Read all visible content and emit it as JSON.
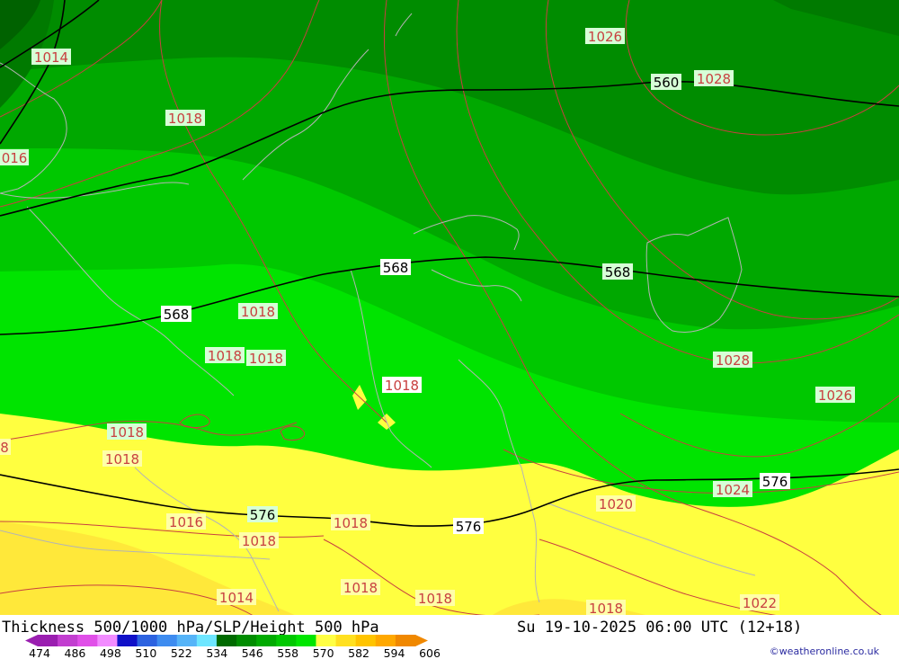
{
  "product_title": "Thickness 500/1000 hPa/SLP/Height 500 hPa",
  "valid_time": "Su 19-10-2025 06:00 UTC (12+18)",
  "credit": "©weatheronline.co.uk",
  "legend": {
    "ticks": [
      "474",
      "486",
      "498",
      "510",
      "522",
      "534",
      "546",
      "558",
      "570",
      "582",
      "594",
      "606"
    ],
    "colors": [
      "#9a1fb0",
      "#c23fd0",
      "#e050e8",
      "#f28cff",
      "#1010c8",
      "#2c62e0",
      "#3e8cf0",
      "#56b4f8",
      "#6ee6ff",
      "#006a00",
      "#008c00",
      "#00aa00",
      "#00c800",
      "#00e600",
      "#ffff44",
      "#ffe020",
      "#ffc400",
      "#ffa800",
      "#f08800"
    ]
  },
  "height_labels": [
    {
      "text": "560"
    },
    {
      "text": "568"
    },
    {
      "text": "568"
    },
    {
      "text": "568"
    },
    {
      "text": "576"
    },
    {
      "text": "576"
    },
    {
      "text": "576"
    }
  ],
  "pressure_labels": [
    {
      "text": "1014"
    },
    {
      "text": "1026"
    },
    {
      "text": "1028"
    },
    {
      "text": "1018"
    },
    {
      "text": "016"
    },
    {
      "text": "1018"
    },
    {
      "text": "1018"
    },
    {
      "text": "1018"
    },
    {
      "text": "1018"
    },
    {
      "text": "1028"
    },
    {
      "text": "1026"
    },
    {
      "text": "1018"
    },
    {
      "text": "1018"
    },
    {
      "text": "1024"
    },
    {
      "text": "1020"
    },
    {
      "text": "1016"
    },
    {
      "text": "1018"
    },
    {
      "text": "1018"
    },
    {
      "text": "1014"
    },
    {
      "text": "1018"
    },
    {
      "text": "1018"
    },
    {
      "text": "1018"
    },
    {
      "text": "1022"
    },
    {
      "text": "8"
    }
  ],
  "colors": {
    "green_darkest": "#007a00",
    "green_dark": "#008c00",
    "green_mid": "#00a800",
    "green_light": "#00c800",
    "green_bright": "#00e400",
    "yellow": "#ffff40",
    "yellow_deep": "#ffe83a",
    "isobar": "#c84040",
    "height_line": "#000000",
    "coast": "#b0b0b0"
  }
}
